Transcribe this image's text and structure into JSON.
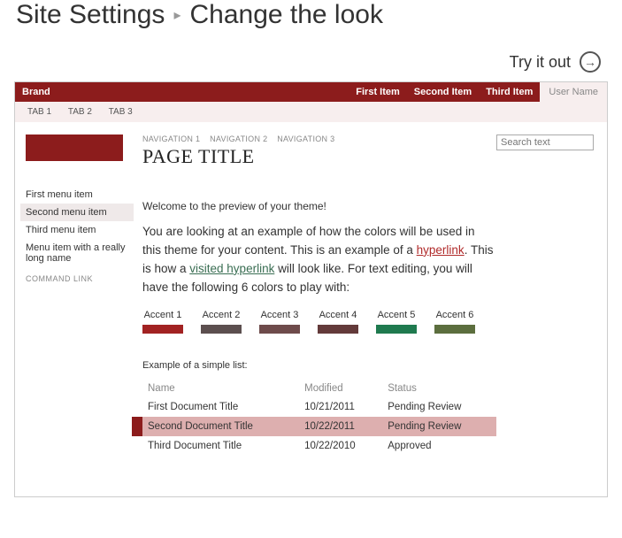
{
  "breadcrumb": {
    "parent": "Site Settings",
    "current": "Change the look"
  },
  "tryout": {
    "label": "Try it out"
  },
  "topbar": {
    "brand": "Brand",
    "items": [
      "First Item",
      "Second Item",
      "Third Item"
    ],
    "user": "User Name"
  },
  "tabs": [
    "TAB 1",
    "TAB 2",
    "TAB 3"
  ],
  "nav": [
    "NAVIGATION 1",
    "NAVIGATION 2",
    "NAVIGATION 3"
  ],
  "page_title": "PAGE TITLE",
  "search_placeholder": "Search text",
  "menu": {
    "items": [
      "First menu item",
      "Second menu item",
      "Third menu item",
      "Menu item with a really long name"
    ],
    "selected_index": 1,
    "command": "COMMAND LINK"
  },
  "welcome": "Welcome to the preview of your theme!",
  "body": {
    "p1a": "You are looking at an example of how the colors will be used in this theme for your content. This is an example of a ",
    "hyperlink": "hyperlink",
    "p1b": ". This is how a ",
    "visited": "visited hyperlink",
    "p1c": " will look like. For text editing, you will have the following 6 colors to play with:"
  },
  "accents": [
    {
      "label": "Accent 1",
      "color": "#a22222"
    },
    {
      "label": "Accent 2",
      "color": "#5c4f4f"
    },
    {
      "label": "Accent 3",
      "color": "#6e4b4b"
    },
    {
      "label": "Accent 4",
      "color": "#633a3a"
    },
    {
      "label": "Accent 5",
      "color": "#1f7a4f"
    },
    {
      "label": "Accent 6",
      "color": "#5c6e3e"
    }
  ],
  "list_label": "Example of a simple list:",
  "table": {
    "headers": [
      "Name",
      "Modified",
      "Status"
    ],
    "rows": [
      {
        "name": "First Document Title",
        "modified": "10/21/2011",
        "status": "Pending Review"
      },
      {
        "name": "Second Document Title",
        "modified": "10/22/2011",
        "status": "Pending Review"
      },
      {
        "name": "Third Document Title",
        "modified": "10/22/2010",
        "status": "Approved"
      }
    ],
    "selected_index": 1
  }
}
